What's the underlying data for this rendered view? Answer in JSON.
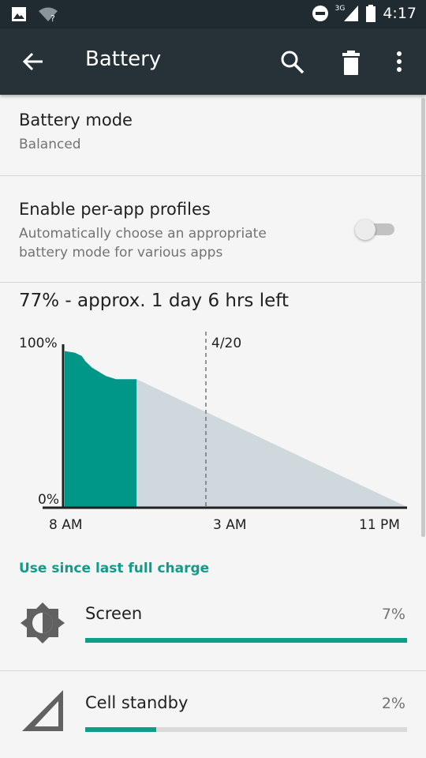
{
  "status_bar": {
    "time": "4:17",
    "network_label": "3G",
    "icons": [
      "image-icon",
      "wifi-unknown-icon",
      "do-not-disturb-icon",
      "cell-signal-icon",
      "battery-icon"
    ]
  },
  "app_bar": {
    "title": "Battery",
    "actions": [
      "back-arrow-icon",
      "search-icon",
      "trash-icon",
      "more-vert-icon"
    ]
  },
  "battery_mode": {
    "title": "Battery mode",
    "value": "Balanced"
  },
  "per_app_profiles": {
    "title": "Enable per-app profiles",
    "summary": "Automatically choose an appropriate battery mode for various apps",
    "enabled": false
  },
  "chart_data": {
    "type": "area",
    "title": "77% - approx. 1 day 6 hrs left",
    "y_ticks": [
      "100%",
      "0%"
    ],
    "x_ticks": [
      "8 AM",
      "3 AM",
      "11 PM"
    ],
    "marker_label": "4/20",
    "ylim": [
      0,
      100
    ],
    "series": [
      {
        "name": "",
        "kind": "history",
        "points": [
          [
            0,
            94
          ],
          [
            3,
            93
          ],
          [
            5,
            91
          ],
          [
            6,
            88
          ],
          [
            8,
            84
          ],
          [
            12,
            79
          ],
          [
            15,
            77
          ],
          [
            17,
            77
          ],
          [
            21,
            77
          ]
        ]
      },
      {
        "name": "",
        "kind": "projection",
        "points": [
          [
            21,
            77
          ],
          [
            100,
            0
          ]
        ]
      }
    ],
    "colors": {
      "history": "#009688",
      "projection": "#cfd8dc",
      "axis": "#212121",
      "marker": "#757575"
    }
  },
  "section": {
    "title": "Use since last full charge"
  },
  "usage_items": [
    {
      "icon": "brightness-icon",
      "label": "Screen",
      "percent": "7%",
      "fill_fraction": 1.0
    },
    {
      "icon": "cell-signal-icon",
      "label": "Cell standby",
      "percent": "2%",
      "fill_fraction": 0.22
    }
  ],
  "colors": {
    "accent": "#0f9d8a",
    "app_bar": "#263238",
    "status_bar": "#1f2b30"
  }
}
